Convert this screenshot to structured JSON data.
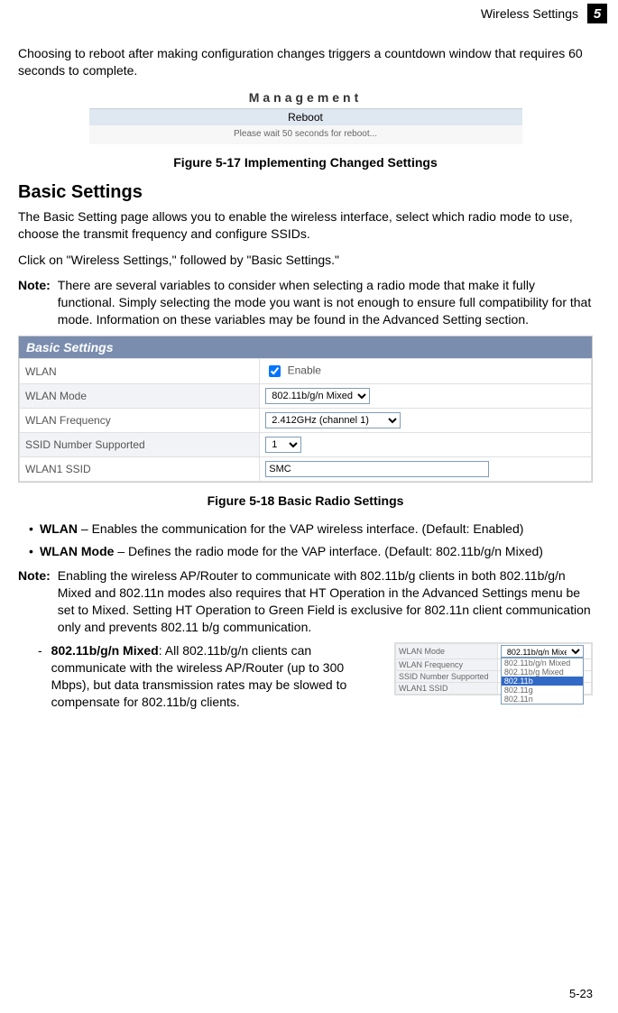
{
  "header": {
    "section_label": "Wireless Settings",
    "chapter_number": "5"
  },
  "intro_paragraph": "Choosing to reboot after making configuration changes triggers a countdown window that requires 60 seconds to complete.",
  "fig17": {
    "mgmt_title": "Management",
    "reboot_label": "Reboot",
    "reboot_msg": "Please wait  50  seconds for reboot...",
    "caption": "Figure 5-17  Implementing Changed Settings"
  },
  "section_heading": "Basic Settings",
  "section_para1": "The Basic Setting page allows you to enable the wireless interface, select which radio mode to use, choose the transmit frequency and configure SSIDs.",
  "section_para2": "Click on \"Wireless Settings,\" followed by \"Basic Settings.\"",
  "note1": {
    "label": "Note:",
    "text": "There are several variables to consider when selecting a radio mode that make it fully functional. Simply selecting the mode you want is not enough to ensure full compatibility for that mode. Information on these variables may be found in the Advanced Setting section."
  },
  "fig18": {
    "header": "Basic Settings",
    "rows": {
      "wlan_label": "WLAN",
      "wlan_enable_text": "Enable",
      "wlan_mode_label": "WLAN Mode",
      "wlan_mode_value": "802.11b/g/n Mixed",
      "wlan_freq_label": "WLAN Frequency",
      "wlan_freq_value": "2.412GHz (channel 1)",
      "ssid_num_label": "SSID Number Supported",
      "ssid_num_value": "1",
      "wlan1_ssid_label": "WLAN1 SSID",
      "wlan1_ssid_value": "SMC"
    },
    "caption": "Figure 5-18  Basic Radio Settings"
  },
  "bullets": {
    "wlan_term": "WLAN",
    "wlan_text": " – Enables the communication for the VAP wireless interface. (Default: Enabled)",
    "wlan_mode_term": "WLAN Mode",
    "wlan_mode_text": " – Defines the radio mode for the VAP interface. (Default: 802.11b/g/n Mixed)"
  },
  "note2": {
    "label": "Note:",
    "text": "Enabling the wireless AP/Router to communicate with 802.11b/g clients in both 802.11b/g/n Mixed and 802.11n modes also requires that HT Operation in the Advanced Settings menu be set to Mixed. Setting HT Operation to Green Field is exclusive for 802.11n client communication only and prevents 802.11 b/g communication."
  },
  "sub_bullet": {
    "term": "802.11b/g/n Mixed",
    "text": ": All 802.11b/g/n clients can communicate with the wireless AP/Router (up to 300 Mbps), but data transmission rates may be slowed to compensate for 802.11b/g clients."
  },
  "mode_fig": {
    "row_labels": {
      "mode": "WLAN Mode",
      "freq": "WLAN Frequency",
      "ssid_num": "SSID Number Supported",
      "wlan1": "WLAN1 SSID"
    },
    "mode_selected": "802.11b/g/n Mixed",
    "options": [
      "802.11b/g/n Mixed",
      "802.11b/g Mixed",
      "802.11b",
      "802.11g",
      "802.11n"
    ],
    "selected_option": "802.11b"
  },
  "page_number": "5-23"
}
